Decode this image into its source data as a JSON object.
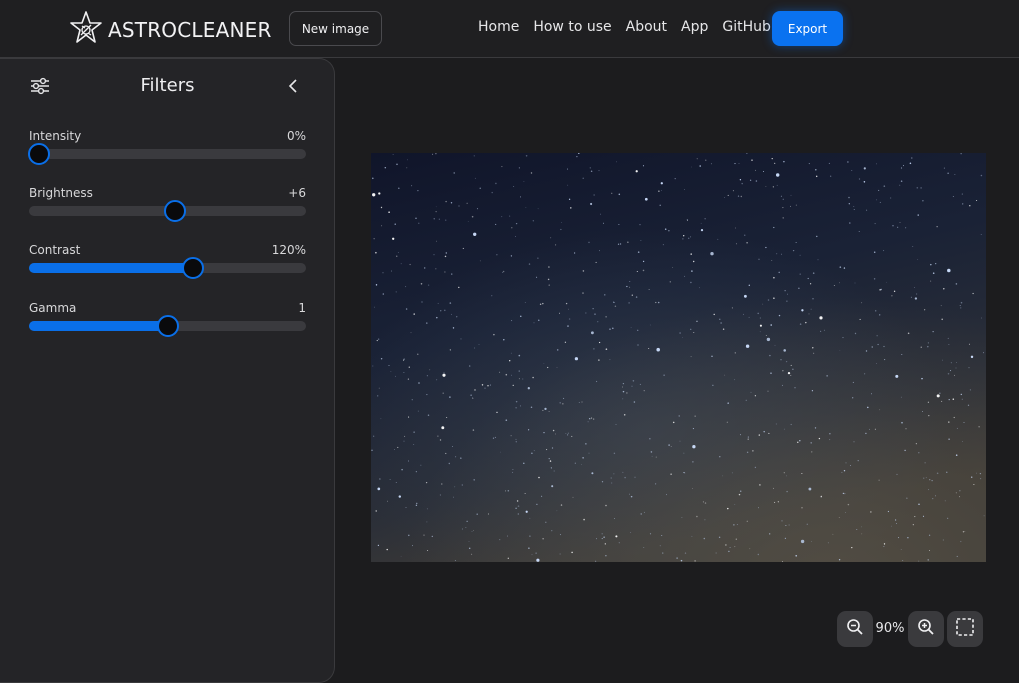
{
  "header": {
    "brand": "ASTROCLEANER",
    "new_image_label": "New image",
    "nav": [
      "Home",
      "How to use",
      "About",
      "App",
      "GitHub"
    ],
    "export_label": "Export"
  },
  "sidebar": {
    "title": "Filters",
    "filters": [
      {
        "label": "Intensity",
        "value": "0%",
        "fraction": 0.0,
        "filled": false
      },
      {
        "label": "Brightness",
        "value": "+6",
        "fraction": 0.53,
        "filled": false
      },
      {
        "label": "Contrast",
        "value": "120%",
        "fraction": 0.6,
        "filled": true
      },
      {
        "label": "Gamma",
        "value": "1",
        "fraction": 0.5,
        "filled": true
      }
    ]
  },
  "zoom": {
    "value": "90%"
  },
  "icons": {
    "logo": "star-logo-icon",
    "settings": "sliders-icon",
    "collapse": "chevron-left-icon",
    "zoom_out": "zoom-out-icon",
    "zoom_in": "zoom-in-icon",
    "fullscreen": "fullscreen-icon"
  },
  "colors": {
    "accent": "#0a72f0",
    "background": "#1c1c1e",
    "panel": "#242427"
  }
}
